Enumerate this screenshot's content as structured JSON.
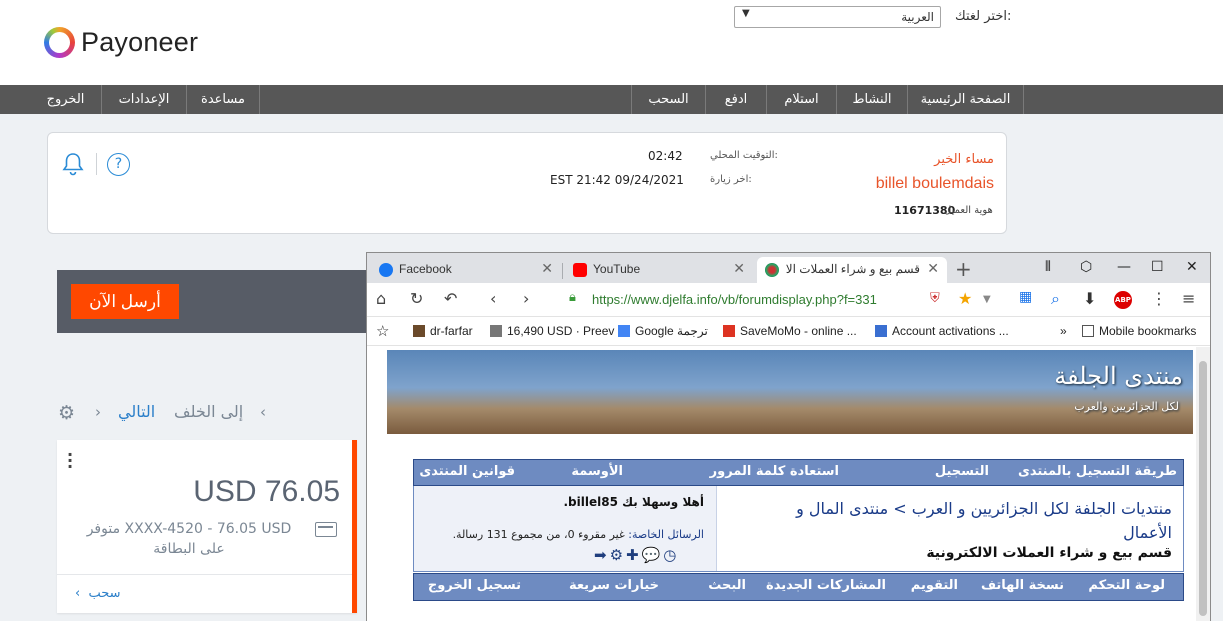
{
  "brand": {
    "name": "Payoneer"
  },
  "language": {
    "label": "اختر لغتك:",
    "selected": "العربية"
  },
  "nav": {
    "items": [
      "الصفحة الرئيسية",
      "النشاط",
      "استلام",
      "ادفع",
      "السحب"
    ],
    "right_items": [
      "مساعدة",
      "الإعدادات",
      "الخروج"
    ]
  },
  "welcome": {
    "greeting": "مساء الخير",
    "username": "billel boulemdais",
    "customer_id_label": "هوية العميل",
    "customer_id": "11671380",
    "local_time_label": "التوقيت المحلي:",
    "local_time": "02:42",
    "last_visit_label": "اخر زيارة:",
    "last_visit": "EST 21:42 09/24/2021"
  },
  "send": {
    "button_label": "أرسل الآن"
  },
  "pager": {
    "next": "التالي",
    "back": "إلى الخلف"
  },
  "balance": {
    "amount": "USD 76.05",
    "detail": "XXXX-4520 - 76.05 USD متوفر على البطاقة",
    "withdraw": "سحب"
  },
  "browser": {
    "tabs": [
      {
        "label": "Facebook",
        "icon": "facebook-icon"
      },
      {
        "label": "YouTube",
        "icon": "youtube-icon"
      },
      {
        "label": "قسم بيع و شراء العملات الالـ",
        "icon": "djelfa-icon"
      }
    ],
    "url": "https://www.djelfa.info/vb/forumdisplay.php?f=331",
    "bookmarks": [
      "dr-farfar",
      "16,490 USD · Preev",
      "Google ترجمة",
      "SaveMoMo - online ...",
      "Account activations ...",
      "Mobile bookmarks"
    ],
    "overflow": "»"
  },
  "forum": {
    "banner_title": "منتدى الجلفة",
    "banner_subtitle": "لكل الجزائريين والعرب",
    "nav": [
      "طريقة التسجيل بالمنتدى",
      "التسجيل",
      "استعادة كلمة المرور",
      "الأوسمة",
      "قوانين المنتدى"
    ],
    "breadcrumb_1": "منتديات الجلفة لكل الجزائريين و العرب > منتدى المال و",
    "breadcrumb_2": "الأعمال",
    "breadcrumb_3": "قسم بيع و شراء العملات الالكترونية",
    "hello": "أهلا وسهلا بك billel85.",
    "pm_label": "الرسائل الخاصة:",
    "pm_text": "غير مقروء 0، من مجموع 131 رسالة.",
    "nav2": [
      "لوحة التحكم",
      "نسخة الهاتف",
      "التقويم",
      "المشاركات الجديدة",
      "البحث",
      "خيارات سريعة",
      "تسجيل الخروج"
    ]
  }
}
